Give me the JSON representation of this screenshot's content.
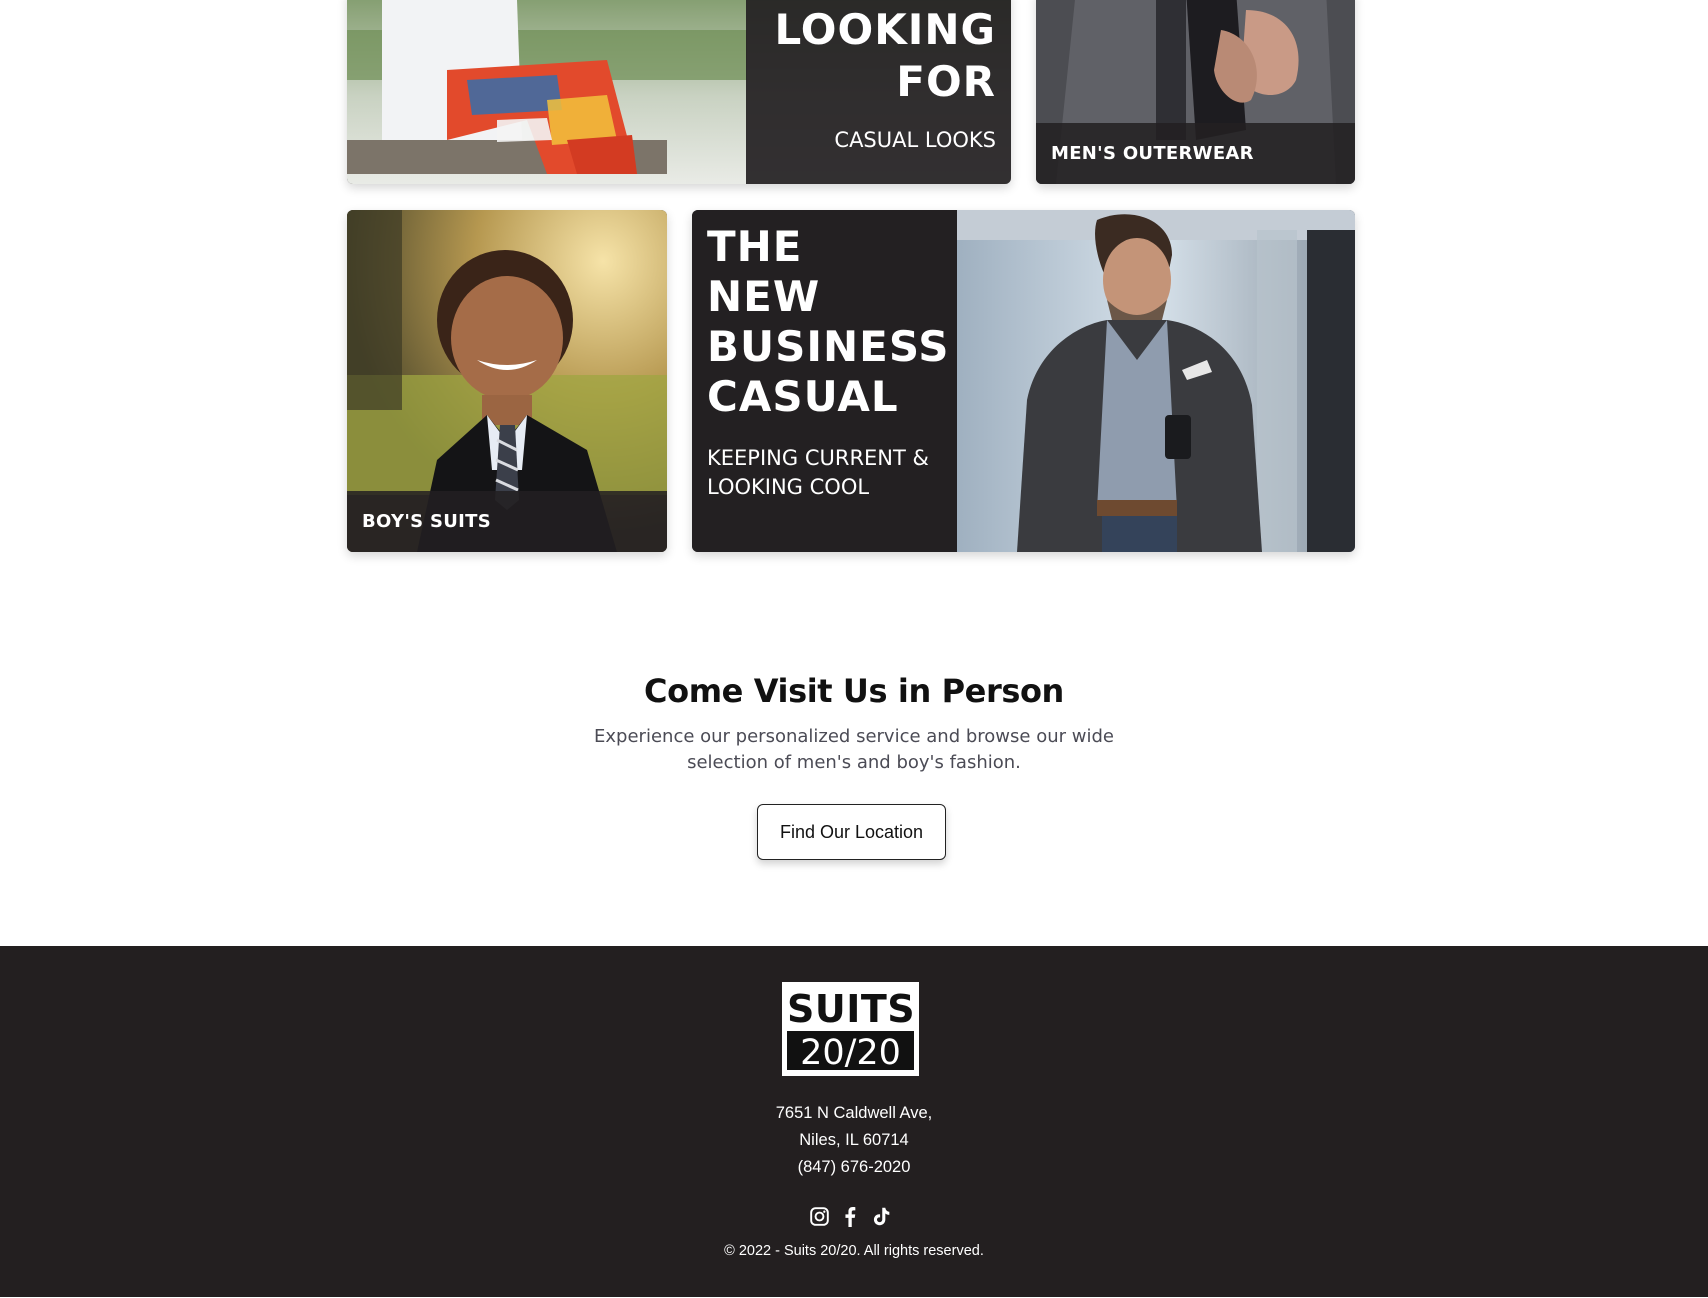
{
  "tiles": {
    "casual": {
      "title_line1": "LOOKING",
      "title_line2": "FOR",
      "subtitle": "CASUAL LOOKS"
    },
    "outerwear": {
      "label": "MEN'S OUTERWEAR"
    },
    "boys": {
      "label": "BOY'S SUITS"
    },
    "business": {
      "title_lines": [
        "THE",
        "NEW",
        "BUSINESS",
        "CASUAL"
      ],
      "subtitle_line1": "KEEPING CURRENT &",
      "subtitle_line2": "LOOKING COOL"
    }
  },
  "visit": {
    "heading": "Come Visit Us in Person",
    "text": "Experience our personalized service and browse our wide selection of men's and boy's fashion.",
    "button_label": "Find Our Location"
  },
  "footer": {
    "logo_top": "SUITS",
    "logo_bottom": "20/20",
    "address_line1": "7651 N Caldwell Ave,",
    "address_line2": "Niles, IL 60714",
    "phone": "(847) 676-2020",
    "social": [
      "instagram-icon",
      "facebook-icon",
      "tiktok-icon"
    ],
    "copyright": "© 2022 - Suits 20/20. All rights reserved."
  },
  "colors": {
    "footer_bg": "#231f20",
    "overlay": "#232022",
    "heading": "#111111",
    "body_text": "#4b4b55"
  }
}
